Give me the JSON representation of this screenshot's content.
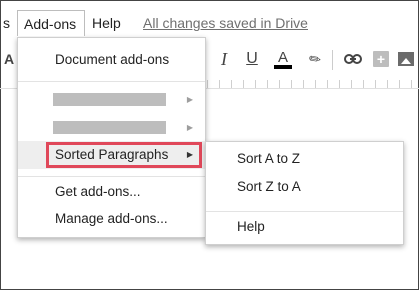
{
  "menubar": {
    "prev_fragment": "s",
    "addons": "Add-ons",
    "help": "Help",
    "saved_status": "All changes saved in Drive"
  },
  "toolbar": {
    "a_fragment": "A",
    "italic": "I",
    "underline": "U",
    "text_color": "A",
    "link_icon": "link-icon",
    "comment_icon": "add-comment-icon",
    "image_icon": "image-icon",
    "highlight_icon": "highlight-icon"
  },
  "addons_menu": {
    "items": [
      {
        "label": "Document add-ons"
      },
      {
        "label": ""
      },
      {
        "label": ""
      },
      {
        "label": "Sorted Paragraphs",
        "selected": true
      },
      {
        "label": "Get add-ons..."
      },
      {
        "label": "Manage add-ons..."
      }
    ],
    "submenu_arrow": "▶"
  },
  "sorted_paragraphs_submenu": {
    "items": [
      {
        "label": "Sort A to Z"
      },
      {
        "label": "Sort Z to A"
      },
      {
        "label": "Help"
      }
    ]
  },
  "colors": {
    "highlight_box": "#e0485a",
    "selected_row": "#eeeeee",
    "placeholder": "#bdbdbd",
    "text_color_bar": "#000000"
  }
}
